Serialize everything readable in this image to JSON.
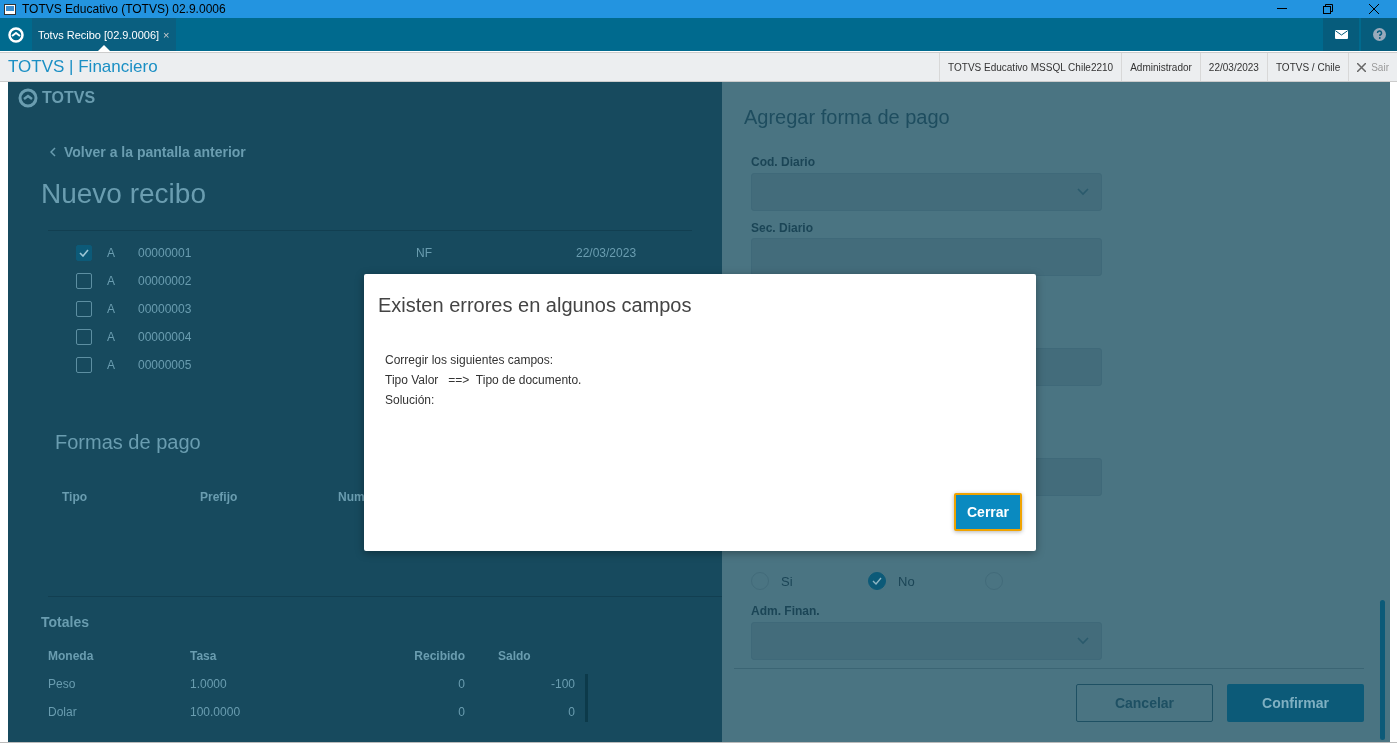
{
  "window": {
    "title": "TOTVS Educativo (TOTVS) 02.9.0006"
  },
  "tabs": [
    {
      "label": "Totvs Recibo [02.9.0006]",
      "selected": true,
      "close": "×"
    }
  ],
  "header": {
    "module": "TOTVS | Financiero",
    "status": [
      "TOTVS Educativo MSSQL Chile2210",
      "Administrador",
      "22/03/2023",
      "TOTVS / Chile"
    ],
    "exit": "Sair"
  },
  "page": {
    "logo": "TOTVS",
    "back": "Volver a la pantalla anterior",
    "title": "Nuevo recibo",
    "documents": [
      {
        "checked": true,
        "prefix": "A",
        "number": "00000001",
        "type": "NF",
        "date": "22/03/2023"
      },
      {
        "checked": false,
        "prefix": "A",
        "number": "00000002"
      },
      {
        "checked": false,
        "prefix": "A",
        "number": "00000003"
      },
      {
        "checked": false,
        "prefix": "A",
        "number": "00000004"
      },
      {
        "checked": false,
        "prefix": "A",
        "number": "00000005"
      }
    ],
    "payments": {
      "title": "Formas de pago",
      "columns": [
        "Tipo",
        "Prefijo",
        "Num"
      ]
    },
    "totals": {
      "title": "Totales",
      "columns": [
        "Moneda",
        "Tasa",
        "Recibido",
        "Saldo"
      ],
      "rows": [
        [
          "Peso",
          "1.0000",
          "0",
          "-100"
        ],
        [
          "Dolar",
          "100.0000",
          "0",
          "0"
        ]
      ]
    }
  },
  "panel": {
    "title": "Agregar forma de pago",
    "fields": [
      {
        "kind": "select",
        "label": "Cod. Diario"
      },
      {
        "kind": "input",
        "label": "Sec. Diario"
      },
      {
        "kind": "input"
      },
      {
        "kind": "input"
      },
      {
        "kind": "radio",
        "options": [
          {
            "label": "Si",
            "selected": false
          },
          {
            "label": "No",
            "selected": true
          },
          {
            "selected": false
          }
        ]
      },
      {
        "kind": "select",
        "label": "Adm. Finan."
      }
    ],
    "buttons": [
      {
        "label": "Cancelar",
        "kind": "secondary"
      },
      {
        "label": "Confirmar",
        "kind": "primary"
      }
    ]
  },
  "dialog": {
    "title": "Existen errores en algunos campos",
    "lines": [
      "Corregir los siguientes campos:",
      "Tipo Valor   ==>  Tipo de documento.",
      "Solución:"
    ],
    "button": "Cerrar"
  }
}
